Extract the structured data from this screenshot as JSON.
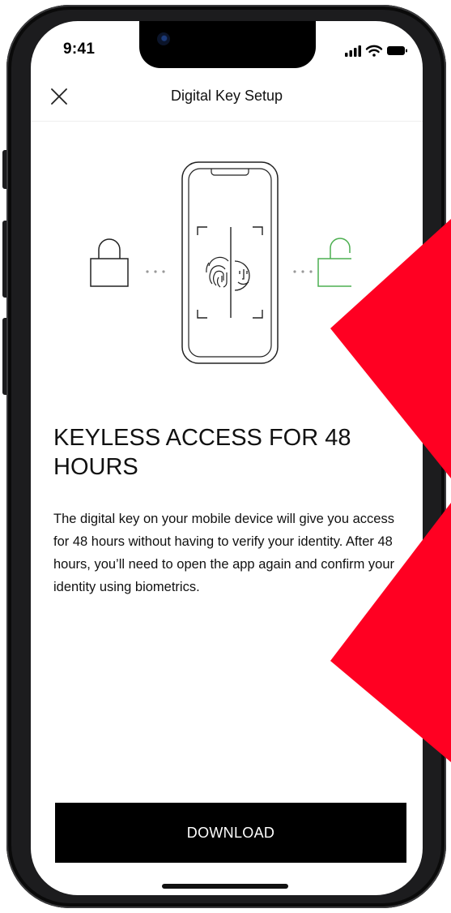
{
  "status_bar": {
    "time": "9:41"
  },
  "header": {
    "title": "Digital Key Setup",
    "close_icon": "close-icon"
  },
  "illustration": {
    "locked_icon": "lock-closed-icon",
    "unlocked_icon": "lock-open-icon",
    "phone_icon": "phone-biometrics-icon",
    "unlock_color": "#4caf50"
  },
  "content": {
    "headline": "KEYLESS ACCESS FOR 48 HOURS",
    "body": "The digital key on your mobile device will give you access for 48 hours without having to verify your identity. After 48 hours, you’ll need to open the app again and confirm your identity using biometrics."
  },
  "actions": {
    "download_label": "DOWNLOAD"
  },
  "colors": {
    "accent_red": "#ff0022",
    "button_bg": "#000000",
    "button_text": "#ffffff"
  }
}
